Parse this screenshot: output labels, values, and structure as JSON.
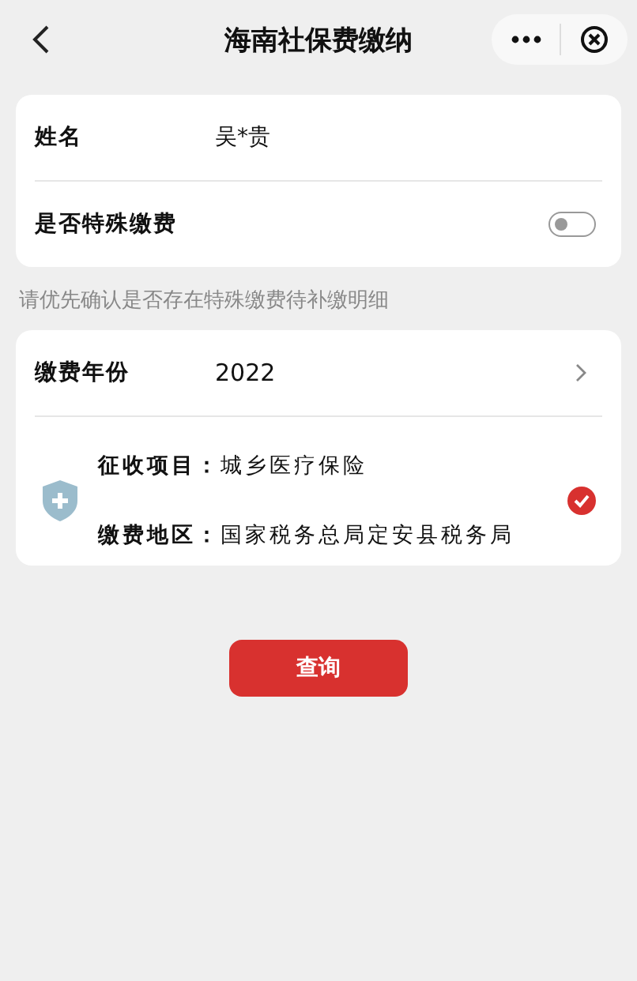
{
  "nav": {
    "title": "海南社保费缴纳"
  },
  "person": {
    "name_label": "姓名",
    "name_value": "吴*贵",
    "special_label": "是否特殊缴费",
    "special_on": false
  },
  "hint": "请优先确认是否存在特殊缴费待补缴明细",
  "payment": {
    "year_label": "缴费年份",
    "year_value": "2022",
    "items": [
      {
        "project_label": "征收项目：",
        "project_value": "城乡医疗保险",
        "region_label": "缴费地区：",
        "region_value": "国家税务总局定安县税务局",
        "selected": true
      }
    ]
  },
  "query_button": "查询"
}
